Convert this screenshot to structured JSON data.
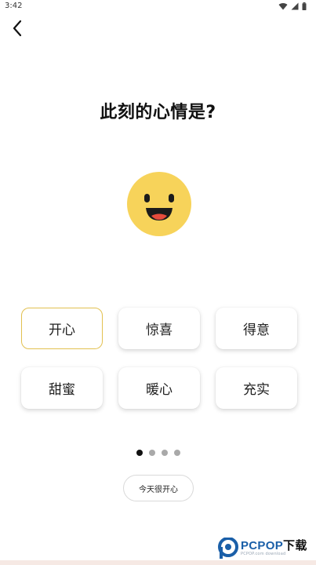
{
  "status_bar": {
    "time": "3:42",
    "icons": [
      "wifi-icon",
      "signal-icon",
      "battery-icon"
    ]
  },
  "nav": {
    "back_icon": "chevron-left-icon"
  },
  "question": "此刻的心情是?",
  "emoji": {
    "name": "smiling-face-icon",
    "color": "#f7d35a"
  },
  "moods": [
    {
      "label": "开心",
      "selected": true
    },
    {
      "label": "惊喜",
      "selected": false
    },
    {
      "label": "得意",
      "selected": false
    },
    {
      "label": "甜蜜",
      "selected": false
    },
    {
      "label": "暖心",
      "selected": false
    },
    {
      "label": "充实",
      "selected": false
    }
  ],
  "pager": {
    "current_page": 1,
    "total_pages": 4
  },
  "confirm_button": "今天很开心",
  "watermark": {
    "text": "PCPOP下载",
    "subtext": "PCPOP.com download",
    "brand_color": "#1a5fa8"
  },
  "colors": {
    "selected_border": "#e2c050",
    "active_dot": "#111111",
    "inactive_dot": "#a9a9a9"
  }
}
